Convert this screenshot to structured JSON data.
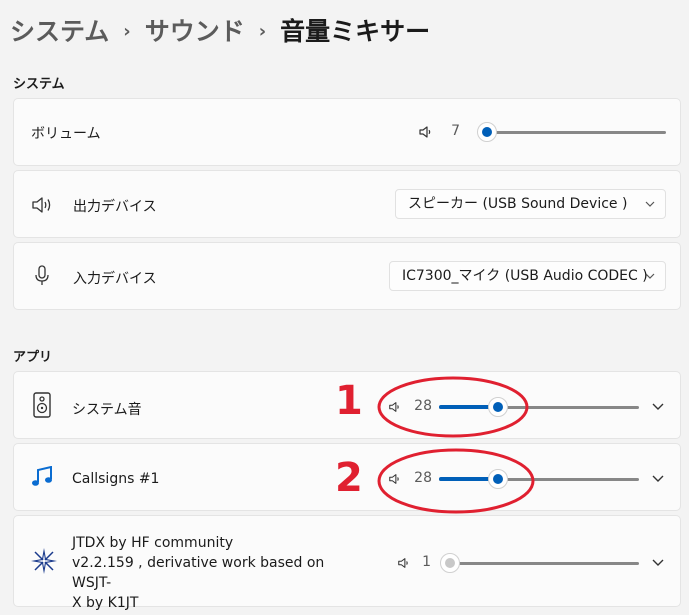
{
  "breadcrumb": {
    "items": [
      "システム",
      "サウンド"
    ],
    "separator": "›",
    "current": "音量ミキサー"
  },
  "system_section": {
    "title": "システム",
    "volume": {
      "label": "ボリューム",
      "value": "7",
      "level": 0.07,
      "icon": "speaker-icon"
    },
    "output_device": {
      "label": "出力デバイス",
      "selected": "スピーカー (USB Sound Device      )",
      "icon": "speaker-icon"
    },
    "input_device": {
      "label": "入力デバイス",
      "selected": "IC7300_マイク (USB Audio CODEC )",
      "icon": "microphone-icon"
    }
  },
  "apps_section": {
    "title": "アプリ",
    "apps": [
      {
        "name": "システム音",
        "volume": "28",
        "level": 0.28,
        "icon": "system-sounds-icon"
      },
      {
        "name": "Callsigns #1",
        "volume": "28",
        "level": 0.28,
        "icon": "music-note-icon"
      },
      {
        "name_lines": [
          "JTDX  by HF community",
          "v2.2.159 , derivative work based on WSJT-",
          "X by K1JT"
        ],
        "volume": "1",
        "level": 0.01,
        "icon": "star-app-icon"
      }
    ]
  },
  "annotations": [
    {
      "number": "1"
    },
    {
      "number": "2"
    }
  ],
  "colors": {
    "accent": "#005fb8",
    "annotation": "#e02030",
    "background": "#f3f3f3"
  }
}
